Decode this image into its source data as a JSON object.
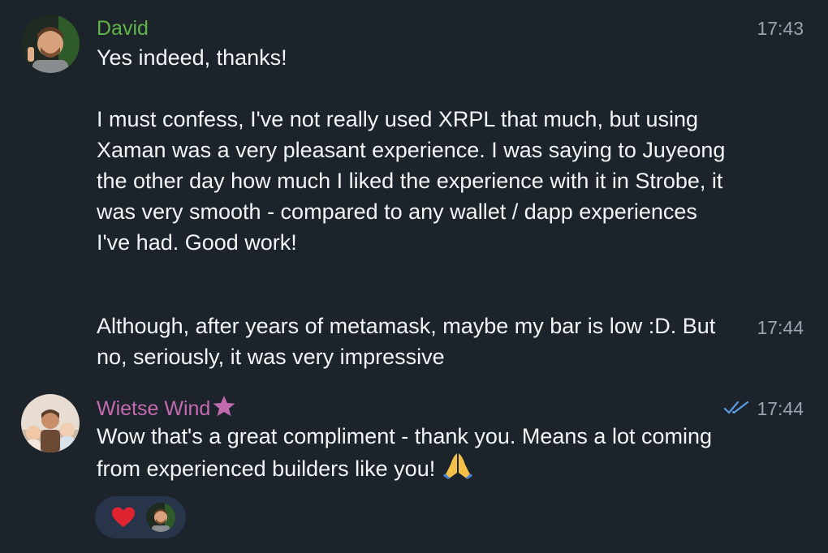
{
  "messages": [
    {
      "sender": "David",
      "time_first": "17:43",
      "text_first": "Yes indeed, thanks!\n\nI must confess, I've not really used XRPL that much, but using Xaman was a very pleasant experience. I was saying to Juyeong the other day how much I liked the experience with it in Strobe, it was very smooth - compared to any wallet / dapp experiences I've had. Good work!",
      "time_second": "17:44",
      "text_second": "Although, after years of metamask, maybe my bar is low :D. But no, seriously, it was very impressive"
    },
    {
      "sender": "Wietse Wind",
      "time": "17:44",
      "text": "Wow that's a great compliment - thank you. Means a lot coming from experienced builders like you!"
    }
  ],
  "colors": {
    "background": "#1d232b",
    "david_name": "#5fb548",
    "wietse_name": "#c26bb0",
    "timestamp": "#9aa4b0",
    "read_check": "#5a9be6",
    "reaction_pill": "#27344a",
    "heart": "#e0242f"
  },
  "icons": {
    "sender_badge": "star-icon",
    "read_status": "double-check-icon",
    "emoji": "pray-icon",
    "reaction": "heart-icon"
  }
}
